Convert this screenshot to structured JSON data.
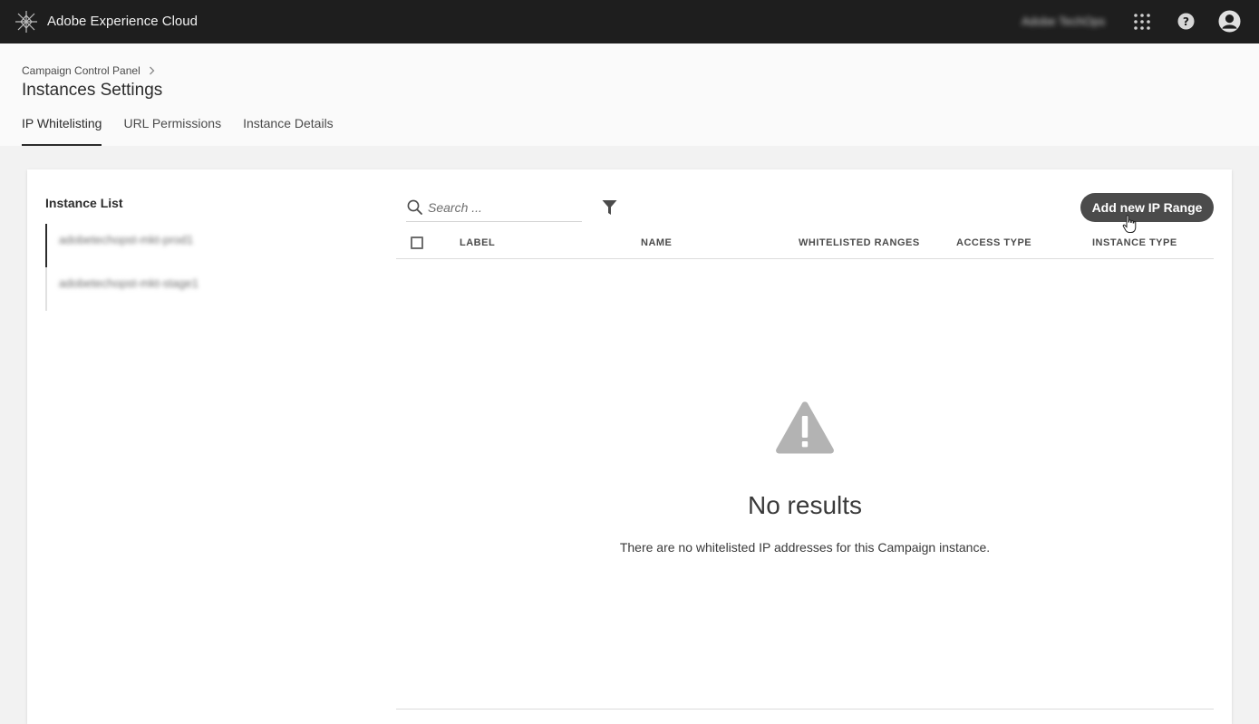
{
  "shell": {
    "app_title": "Adobe Experience Cloud",
    "org_name": "Adobe TechOps",
    "icons": [
      "adobe-logo-icon",
      "apps-grid-icon",
      "help-icon",
      "user-avatar-icon"
    ]
  },
  "header": {
    "breadcrumb": "Campaign Control Panel",
    "title": "Instances Settings",
    "tabs": [
      {
        "label": "IP Whitelisting",
        "active": true
      },
      {
        "label": "URL Permissions",
        "active": false
      },
      {
        "label": "Instance Details",
        "active": false
      }
    ]
  },
  "sidebar": {
    "title": "Instance List",
    "items": [
      {
        "label": "adobetechopst-mkt-prod1",
        "selected": true
      },
      {
        "label": "adobetechopst-mkt-stage1",
        "selected": false
      }
    ]
  },
  "toolbar": {
    "search_placeholder": "Search ...",
    "add_button_label": "Add new IP Range"
  },
  "table": {
    "columns": [
      "LABEL",
      "NAME",
      "WHITELISTED RANGES",
      "ACCESS TYPE",
      "INSTANCE TYPE"
    ],
    "rows": []
  },
  "empty_state": {
    "title": "No results",
    "message": "There are no whitelisted IP addresses for this Campaign instance."
  },
  "colors": {
    "shell_bg": "#1e1e1e",
    "button_bg": "#4b4b4b",
    "page_bg": "#f2f2f2"
  }
}
